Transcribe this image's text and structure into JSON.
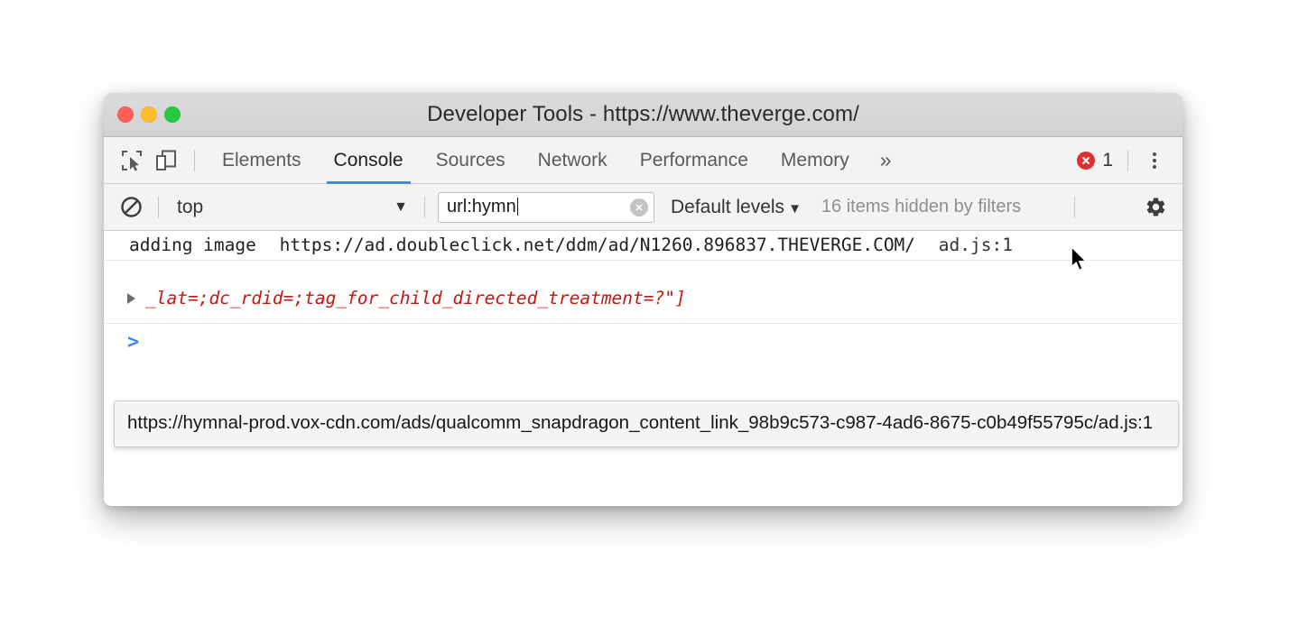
{
  "window": {
    "title": "Developer Tools - https://www.theverge.com/",
    "traffic_lights": [
      {
        "name": "close",
        "color": "#ff5f57"
      },
      {
        "name": "minimize",
        "color": "#febc2e"
      },
      {
        "name": "zoom",
        "color": "#28c840"
      }
    ]
  },
  "toolbar": {
    "inspect_icon": "inspect-element-icon",
    "device_icon": "device-toolbar-icon",
    "tabs": [
      {
        "label": "Elements",
        "active": false
      },
      {
        "label": "Console",
        "active": true
      },
      {
        "label": "Sources",
        "active": false
      },
      {
        "label": "Network",
        "active": false
      },
      {
        "label": "Performance",
        "active": false
      },
      {
        "label": "Memory",
        "active": false
      }
    ],
    "more_tabs_label": "»",
    "error_count": "1",
    "error_icon": "error-circle-icon",
    "menu_icon": "kebab-menu-icon",
    "accent_color": "#4285f4",
    "error_color": "#e03131"
  },
  "filterbar": {
    "clear_console_icon": "block-clear-icon",
    "context_value": "top",
    "context_caret": "▼",
    "filter_value": "url:hymn",
    "filter_placeholder": "Filter",
    "clear_filter_icon": "clear-input-icon",
    "levels_label": "Default levels",
    "levels_caret": "▼",
    "hidden_items_note": "16 items hidden by filters",
    "settings_icon": "gear-icon"
  },
  "console": {
    "rows": [
      {
        "message": "adding image",
        "url": "https://ad.doubleclick.net/ddm/ad/N1260.896837.THEVERGE.COM/",
        "source": "ad.js:1"
      },
      {
        "error_text": "_lat=;dc_rdid=;tag_for_child_directed_treatment=?\"]",
        "expand_icon": "disclosure-triangle-icon"
      }
    ],
    "prompt_caret": ">"
  },
  "tooltip": {
    "text": "https://hymnal-prod.vox-cdn.com/ads/qualcomm_snapdragon_content_link_98b9c573-c987-4ad6-8675-c0b49f55795c/ad.js:1"
  },
  "cursor": {
    "icon": "mouse-pointer-arrow"
  }
}
